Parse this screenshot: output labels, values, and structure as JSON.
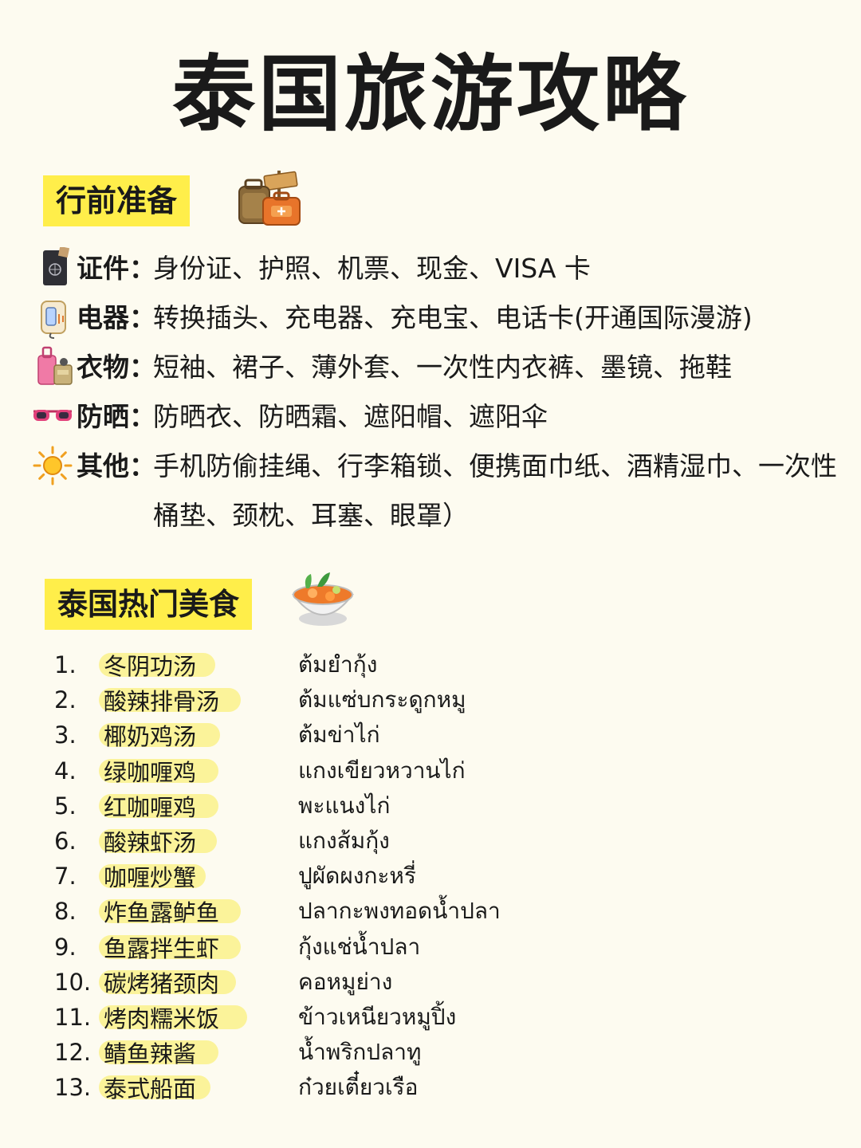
{
  "title": "泰国旅游攻略",
  "sections": {
    "prep": {
      "label": "行前准备",
      "items": [
        {
          "icon": "passport-icon",
          "label": "证件",
          "text": "身份证、护照、机票、现金、VISA 卡"
        },
        {
          "icon": "charger-icon",
          "label": "电器",
          "text": "转换插头、充电器、充电宝、电话卡(开通国际漫游)"
        },
        {
          "icon": "luggage-icon",
          "label": "衣物",
          "text": "短袖、裙子、薄外套、一次性内衣裤、墨镜、拖鞋"
        },
        {
          "icon": "sunglasses-icon",
          "label": "防晒",
          "text": "防晒衣、防晒霜、遮阳帽、遮阳伞"
        },
        {
          "icon": "sun-icon",
          "label": "其他",
          "text": "手机防偷挂绳、行李箱锁、便携面巾纸、酒精湿巾、一次性桶垫、颈枕、耳塞、眼罩）"
        }
      ]
    },
    "food": {
      "label": "泰国热门美食",
      "items": [
        {
          "num": "1.",
          "cn": "冬阴功汤",
          "th": "ต้มยำกุ้ง"
        },
        {
          "num": "2.",
          "cn": "酸辣排骨汤",
          "th": "ต้มแซ่บกระดูกหมู"
        },
        {
          "num": "3.",
          "cn": "椰奶鸡汤",
          "th": "ต้มข่าไก่"
        },
        {
          "num": "4.",
          "cn": "绿咖喱鸡",
          "th": "แกงเขียวหวานไก่"
        },
        {
          "num": "5.",
          "cn": "红咖喱鸡",
          "th": "พะแนงไก่"
        },
        {
          "num": "6.",
          "cn": "酸辣虾汤",
          "th": "แกงส้มกุ้ง"
        },
        {
          "num": "7.",
          "cn": "咖喱炒蟹",
          "th": "ปูผัดผงกะหรี่"
        },
        {
          "num": "8.",
          "cn": "炸鱼露鲈鱼",
          "th": "ปลากะพงทอดน้ำปลา"
        },
        {
          "num": "9.",
          "cn": "鱼露拌生虾",
          "th": "กุ้งแช่น้ำปลา"
        },
        {
          "num": "10.",
          "cn": "碳烤猪颈肉",
          "th": "คอหมูย่าง"
        },
        {
          "num": "11.",
          "cn": "烤肉糯米饭",
          "th": "ข้าวเหนียวหมูปิ้ง"
        },
        {
          "num": "12.",
          "cn": "鲭鱼辣酱",
          "th": "น้ำพริกปลาทู"
        },
        {
          "num": "13.",
          "cn": "泰式船面",
          "th": "ก๋วยเตี๋ยวเรือ"
        }
      ]
    }
  },
  "colors": {
    "background": "#FDFBF0",
    "label_highlight": "#FFEE4A",
    "food_highlight": "#FBF39A"
  }
}
